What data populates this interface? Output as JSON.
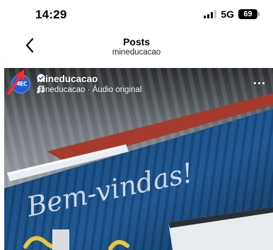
{
  "status_bar": {
    "time": "14:29",
    "network": "5G",
    "battery": "69",
    "icons": [
      "signal-icon",
      "battery-icon"
    ]
  },
  "header": {
    "title": "Posts",
    "subtitle": "mineducacao",
    "back_icon": "chevron-left-icon"
  },
  "post": {
    "avatar_text": "MEC",
    "username": "mineducacao",
    "verified_icon": "verified-badge-icon",
    "audio_icon": "music-note-icon",
    "audio_label": "mineducacao · Áudio original",
    "more_icon": "more-horizontal-icon",
    "media_text": "Bem-vindas!",
    "annotation": "red-arrow-icon",
    "colors": {
      "wall_blue": "#1f4f86",
      "ceiling_gray": "#8a8f94",
      "annotation_red": "#ff2a2a",
      "avatar_blue": "#1d5fd8"
    }
  }
}
